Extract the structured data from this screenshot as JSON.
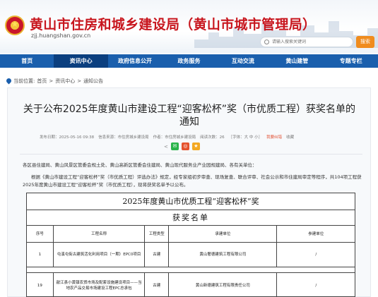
{
  "header": {
    "site_title": "黄山市住房和城乡建设局（黄山市城市管理局）",
    "site_url": "zjj.huangshan.gov.cn",
    "search_placeholder": "请输入搜索关键词",
    "search_button": "搜索"
  },
  "nav": {
    "items": [
      {
        "label": "首页"
      },
      {
        "label": "资讯中心"
      },
      {
        "label": "政府信息公开"
      },
      {
        "label": "政务服务"
      },
      {
        "label": "互动交流"
      },
      {
        "label": "黄山建管"
      },
      {
        "label": "专题专栏"
      }
    ],
    "active_index": 1
  },
  "breadcrumb": {
    "prefix": "当前位置:",
    "items": [
      "首页",
      "资讯中心",
      "通知公告"
    ],
    "separator": ">"
  },
  "article": {
    "title": "关于公布2025年度黄山市建设工程“迎客松杯”奖（市优质工程）获奖名单的通知",
    "meta": {
      "published": "发布日期：2025-05-16 09:38",
      "source": "信息来源：市住房城乡建设局",
      "author": "作者：市住房城乡建设局",
      "views": "阅读次数：26",
      "font_size": "［字体：大 中 小］",
      "my_info": "我要纠错",
      "favorite": "收藏"
    },
    "share_label": "<",
    "paragraph1": "各区县住建局、黄山风景区管委会规土处、黄山高新区管委会住建局、黄山现代服务业产业园规建局、各有关单位：",
    "paragraph2": "根据《黄山市建设工程“迎客松杯”奖（市优质工程）评选办法》规定，经专家组初步审查、现场复查、联合评审、社会公示和市住建局审定等程序，共104项工程获2025年度黄山市建设工程“迎客松杯”奖（市优质工程），现将获奖名单予以公布。"
  },
  "document": {
    "heading": "2025年度黄山市优质工程“迎客松杯”奖",
    "subheading": "获奖名单",
    "columns": [
      "序号",
      "工程名称",
      "工程类型",
      "承建单位",
      "参建单位"
    ],
    "rows": [
      {
        "no": "1",
        "name": "屯溪屯街古建筑活化利用项目（一期）EPC0项目",
        "type": "古建",
        "builder": "黄山奢德建筑工程有限公司",
        "partner": "/"
      },
      {
        "no": "19",
        "name": "歙江县小黄镇农贸市场及配套设施建设项目——当地农产品交易市场建设工程EPC总承包",
        "type": "古建",
        "builder": "黄山新德建筑工程有限责任公司",
        "partner": "/"
      }
    ]
  },
  "colors": {
    "nav_bg": "#1a5fad",
    "nav_active": "#0b3f7f",
    "title_red": "#c8161e",
    "search_orange": "#f08c1e"
  }
}
